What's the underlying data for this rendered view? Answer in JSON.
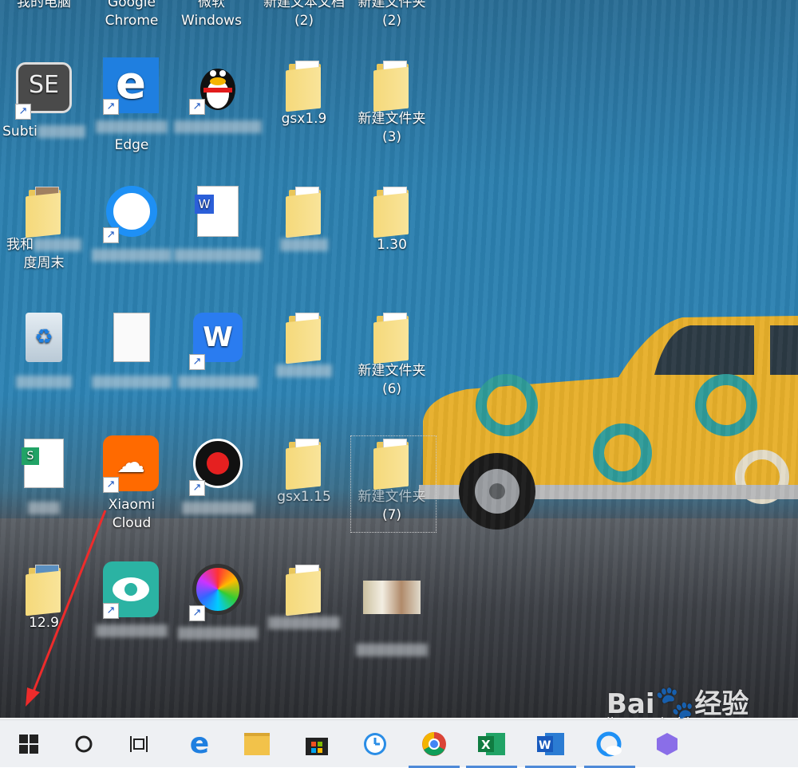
{
  "desktop": {
    "top_row_labels": [
      "我的电脑",
      "Google Chrome",
      "微软 Windows",
      "新建文本文档 (2)",
      "新建文件夹 (2)"
    ],
    "icons": [
      {
        "id": "subtitle-edit",
        "label": "Subti",
        "type": "app",
        "shortcut": true,
        "color": "#555",
        "text": "SE"
      },
      {
        "id": "edge",
        "label1": "Mi",
        "label2": "Edge",
        "type": "app",
        "shortcut": true,
        "color": "#1f7fe0"
      },
      {
        "id": "qq",
        "label": "腾讯QQ",
        "type": "app",
        "shortcut": true
      },
      {
        "id": "gsx19",
        "label": "gsx1.9",
        "type": "folder"
      },
      {
        "id": "new-folder-3",
        "label1": "新建文件夹",
        "label2": "(3)",
        "type": "folder"
      },
      {
        "id": "album",
        "label1": "我和",
        "label2": "度周末",
        "type": "folder"
      },
      {
        "id": "qq-browser",
        "label": "QQ浏览器",
        "type": "app",
        "shortcut": true
      },
      {
        "id": "word-doc",
        "label": "",
        "type": "doc"
      },
      {
        "id": "folder-r2c4",
        "label": "",
        "type": "folder"
      },
      {
        "id": "folder-130",
        "label": "1.30",
        "type": "folder"
      },
      {
        "id": "recycle-bin",
        "label": "",
        "type": "app"
      },
      {
        "id": "text-doc",
        "label": "",
        "type": "doc"
      },
      {
        "id": "wps",
        "label": "WPS 2019",
        "type": "app",
        "shortcut": true
      },
      {
        "id": "folder-r3c4",
        "label": "",
        "type": "folder"
      },
      {
        "id": "new-folder-6",
        "label1": "新建文件夹",
        "label2": "(6)",
        "type": "folder"
      },
      {
        "id": "sheet",
        "label": "",
        "type": "app"
      },
      {
        "id": "xiaomi-cloud",
        "label1": "Xiaomi",
        "label2": "Cloud",
        "type": "app",
        "shortcut": true
      },
      {
        "id": "recorder",
        "label": "",
        "type": "app",
        "shortcut": true
      },
      {
        "id": "gsx115",
        "label": "gsx1.15",
        "type": "folder"
      },
      {
        "id": "new-folder-7",
        "label1": "新建文件夹",
        "label2": "(7)",
        "type": "folder"
      },
      {
        "id": "folder-129",
        "label": "12.9",
        "type": "folder"
      },
      {
        "id": "eye-care",
        "label": "护眼宝",
        "type": "app",
        "shortcut": true
      },
      {
        "id": "color-picker",
        "label": "",
        "type": "app",
        "shortcut": true
      },
      {
        "id": "new-folder-b",
        "label": "新建文件夹",
        "type": "folder"
      },
      {
        "id": "image-2020",
        "label": "2020_副本",
        "type": "image"
      }
    ]
  },
  "taskbar": {
    "items": [
      "start",
      "search",
      "task-view",
      "edge",
      "file-explorer",
      "store",
      "clock-app",
      "chrome",
      "excel",
      "word",
      "qq-browser",
      "app"
    ]
  },
  "watermark": {
    "brand": "Bai",
    "brand2": "经验",
    "url": "jingyan.baidu.com"
  }
}
